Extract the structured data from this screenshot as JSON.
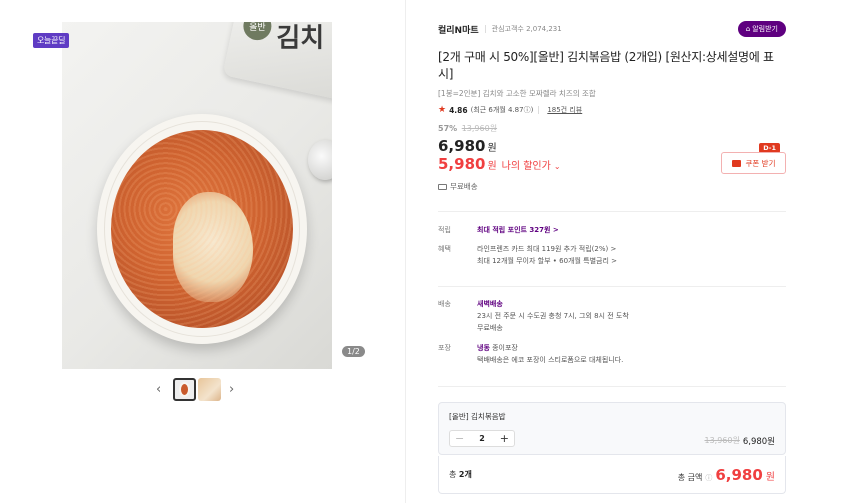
{
  "gallery": {
    "badge": "오늘끝딜",
    "package_text": "김치",
    "package_logo": "올반",
    "page_indicator": "1/2",
    "prev_icon": "chevron-left-icon",
    "next_icon": "chevron-right-icon"
  },
  "seller": {
    "name": "컬리N마트",
    "followers_label": "관심고객수 2,074,231",
    "alarm_button": "알림받기"
  },
  "product": {
    "title": "[2개 구매 시 50%][올반] 김치볶음밥 (2개입) [원산지:상세설명에 표시]",
    "subtitle": "[1봉=2인분] 김치와 고소한 모짜렐라 치즈의 조합",
    "rating": "4.86",
    "rating_detail": "(최근 6개월 4.87ⓘ)",
    "reviews_link": "185건 리뷰",
    "discount_pct": "57%",
    "original_price": "13,960원",
    "price": "6,980",
    "price_unit": "원",
    "my_price": "5,980",
    "my_price_unit": "원",
    "my_price_label": "나의 할인가",
    "coupon_button": "쿠폰 받기",
    "coupon_badge": "D-1",
    "free_shipping": "무료배송"
  },
  "benefits": {
    "points_label": "적립",
    "points_value": "최대 적립 포인트 327원 >",
    "benefit_label": "혜택",
    "benefit_line1": "라인프렌즈 카드 최대 119원 추가 적립(2%) >",
    "benefit_line2": "최대 12개월 무이자 할부 • 60개월 특별금리 >"
  },
  "delivery": {
    "delivery_label": "배송",
    "delivery_type": "새벽배송",
    "delivery_line1": "23시 전 주문 시 수도권 충청 7시, 그외 8시 전 도착",
    "delivery_line2": "무료배송",
    "packing_label": "포장",
    "packing_type": "냉동",
    "packing_type_rest": " 종이포장",
    "packing_line1": "택배배송은 에코 포장이 스티로폼으로 대체됩니다."
  },
  "option": {
    "name": "[올반] 김치볶음밥",
    "minus": "−",
    "qty": "2",
    "plus": "+",
    "original_total": "13,960원",
    "sale_total": "6,980원"
  },
  "total": {
    "count_prefix": "총 ",
    "count": "2개",
    "label": "총 금액",
    "info": "ⓘ",
    "price": "6,980",
    "unit": "원"
  }
}
